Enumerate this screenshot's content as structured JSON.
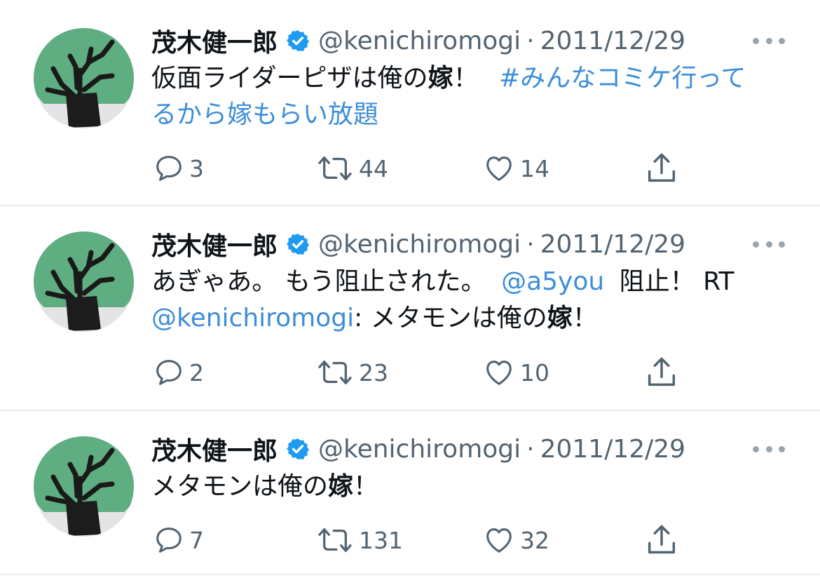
{
  "tweets": [
    {
      "name": "茂木健一郎",
      "handle": "@kenichiromogi",
      "sep": "·",
      "date": "2011/12/29",
      "text_before": "仮面ライダーピザは俺の",
      "text_bold": "嫁",
      "text_after": "！",
      "hashtag_line1": "#みんなコミケ行って",
      "hashtag_line2": "るから嫁もらい放題",
      "replies": "3",
      "retweets": "44",
      "likes": "14"
    },
    {
      "name": "茂木健一郎",
      "handle": "@kenichiromogi",
      "sep": "·",
      "date": "2011/12/29",
      "text_part1": "あぎゃあ。 もう阻止された。 ",
      "mention1": "@a5you",
      "text_part2": " 阻止！ RT",
      "mention2": "@kenichiromogi",
      "text_part3": ": メタモンは俺の",
      "text_bold": "嫁",
      "text_after": "！",
      "replies": "2",
      "retweets": "23",
      "likes": "10"
    },
    {
      "name": "茂木健一郎",
      "handle": "@kenichiromogi",
      "sep": "·",
      "date": "2011/12/29",
      "text_before": "メタモンは俺の",
      "text_bold": "嫁",
      "text_after": "！",
      "replies": "7",
      "retweets": "131",
      "likes": "32"
    }
  ],
  "icons": {
    "verified": "verified-badge-icon",
    "more": "more-horizontal-icon",
    "reply": "reply-bubble-icon",
    "retweet": "retweet-icon",
    "like": "heart-icon",
    "share": "share-upload-icon"
  },
  "colors": {
    "link": "#3d8ed8",
    "verified": "#1d9bf0",
    "muted": "#536471",
    "divider": "#e6e9ec"
  }
}
